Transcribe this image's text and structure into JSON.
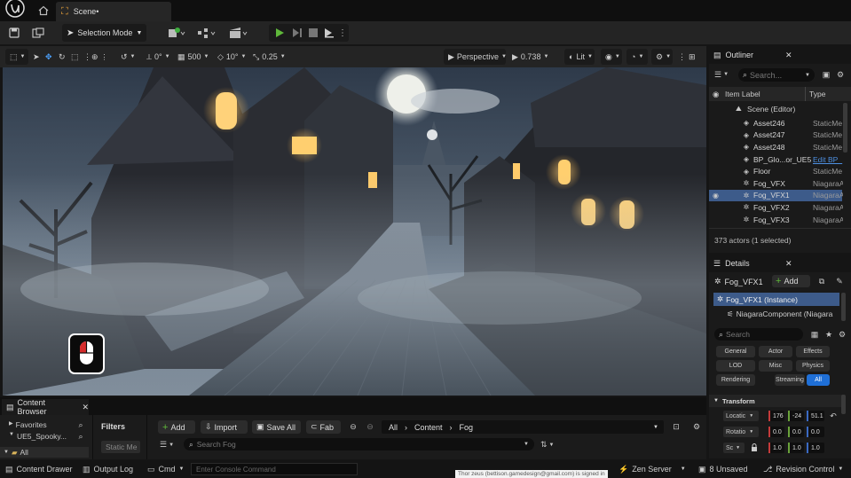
{
  "window": {
    "tab_title": "Scene•"
  },
  "toolbar": {
    "selection_mode": "Selection Mode"
  },
  "viewport_toolbar": {
    "rotation_snap": "0°",
    "grid_snap": "500",
    "angle_snap": "10°",
    "scale_snap": "0.25",
    "view_mode": "Perspective",
    "camera_speed": "0.738",
    "lighting_mode": "Lit"
  },
  "outliner": {
    "title": "Outliner",
    "search_placeholder": "Search...",
    "col_label": "Item Label",
    "col_type": "Type",
    "scene_root": "Scene (Editor)",
    "items": [
      {
        "label": "Asset246",
        "type": "StaticMe"
      },
      {
        "label": "Asset247",
        "type": "StaticMe"
      },
      {
        "label": "Asset248",
        "type": "StaticMe"
      },
      {
        "label": "BP_Glo...or_UE5",
        "type": "Edit BP_"
      },
      {
        "label": "Floor",
        "type": "StaticMe"
      },
      {
        "label": "Fog_VFX",
        "type": "NiagaraA"
      },
      {
        "label": "Fog_VFX1",
        "type": "NiagaraA"
      },
      {
        "label": "Fog_VFX2",
        "type": "NiagaraA"
      },
      {
        "label": "Fog_VFX3",
        "type": "NiagaraA"
      }
    ],
    "actor_count": "373 actors (1 selected)"
  },
  "details": {
    "title": "Details",
    "actor_name": "Fog_VFX1",
    "add_label": "Add",
    "instance_label": "Fog_VFX1 (Instance)",
    "component_label": "NiagaraComponent (Niagara",
    "search_placeholder": "Search",
    "filter_chips": [
      [
        "General",
        "Actor",
        "Effects"
      ],
      [
        "LOD",
        "Misc",
        "Physics"
      ],
      [
        "Rendering",
        "Streaming",
        "All"
      ]
    ],
    "transform_section": "Transform",
    "location_label": "Locatic",
    "rotation_label": "Rotatio",
    "scale_label": "Sc",
    "location": [
      "176",
      "-24",
      "51.1"
    ],
    "rotation": [
      "0.0",
      "0.0",
      "0.0"
    ],
    "scale": [
      "1.0",
      "1.0",
      "1.0"
    ],
    "colors": {
      "x": "#c43a3a",
      "y": "#6aa33a",
      "z": "#3a6ac4",
      "accent": "#1f6fd6"
    }
  },
  "content_browser": {
    "tab_label": "Content Browser",
    "favorites_label": "Favorites",
    "project_label": "UE5_Spooky...",
    "all_label": "All",
    "filters_label": "Filters",
    "filter_chip": "Static Me",
    "add_label": "Add",
    "import_label": "Import",
    "save_all_label": "Save All",
    "fab_label": "Fab",
    "path": [
      "All",
      "Content",
      "Fog"
    ],
    "search_placeholder": "Search Fog"
  },
  "statusbar": {
    "content_drawer": "Content Drawer",
    "output_log": "Output Log",
    "cmd_label": "Cmd",
    "console_placeholder": "Enter Console Command",
    "signed_in_notice": "Thor zeus (bettison.gamedesign@gmail.com) is signed in",
    "zen_server": "Zen Server",
    "unsaved": "8 Unsaved",
    "revision_control": "Revision Control"
  }
}
